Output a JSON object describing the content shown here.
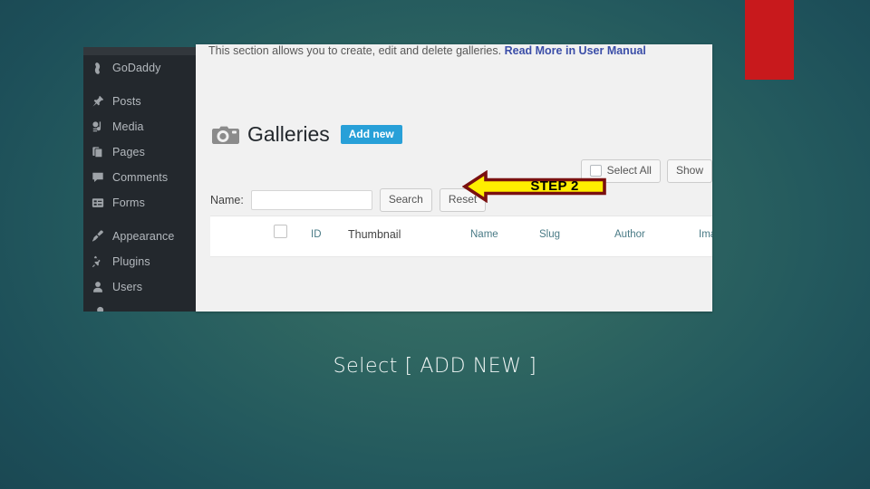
{
  "slide": {
    "caption": "Select [ ADD NEW ]",
    "background_color": "#2b6460",
    "accent_block_color": "#c8191c"
  },
  "annotation": {
    "step_label": "STEP 2",
    "fill_color": "#ffee00",
    "border_color": "#7a1010",
    "direction": "left"
  },
  "screenshot": {
    "sidebar": {
      "items": [
        {
          "label": "GoDaddy",
          "icon": "godaddy-icon"
        },
        {
          "label": "Posts",
          "icon": "pin-icon"
        },
        {
          "label": "Media",
          "icon": "media-icon"
        },
        {
          "label": "Pages",
          "icon": "pages-icon"
        },
        {
          "label": "Comments",
          "icon": "comment-icon"
        },
        {
          "label": "Forms",
          "icon": "forms-icon"
        },
        {
          "label": "Appearance",
          "icon": "paintbrush-icon"
        },
        {
          "label": "Plugins",
          "icon": "plug-icon"
        },
        {
          "label": "Users",
          "icon": "user-icon"
        }
      ]
    },
    "content": {
      "intro_text": "This section allows you to create, edit and delete galleries.",
      "intro_link": "Read More in User Manual",
      "page_title": "Galleries",
      "add_new_label": "Add new",
      "select_all_label": "Select All",
      "show_label": "Show",
      "search": {
        "name_label": "Name:",
        "value": "",
        "placeholder": "",
        "search_label": "Search",
        "reset_label": "Reset"
      },
      "table": {
        "columns": [
          {
            "label": "ID"
          },
          {
            "label": "Thumbnail"
          },
          {
            "label": "Name"
          },
          {
            "label": "Slug"
          },
          {
            "label": "Author"
          },
          {
            "label": "Imag"
          }
        ],
        "rows": []
      }
    }
  }
}
